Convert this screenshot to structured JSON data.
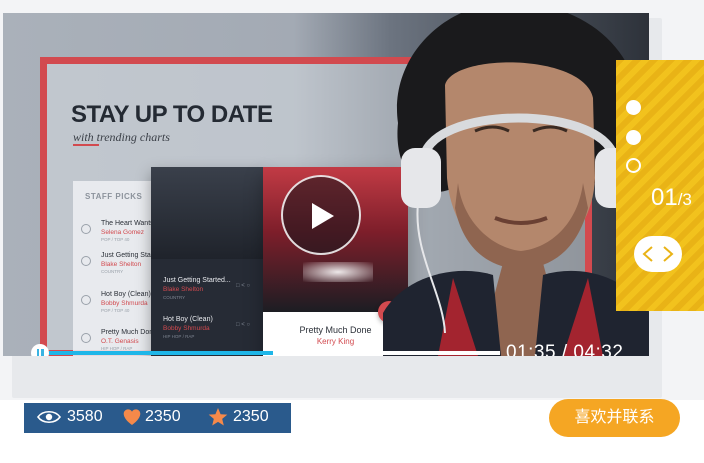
{
  "slide": {
    "title": "STAY UP TO DATE",
    "subtitle": "with trending charts"
  },
  "staff_picks": {
    "heading": "STAFF PICKS",
    "items": [
      {
        "title": "The Heart Wants",
        "artist": "Selena Gomez",
        "genre": "POP / TOP 40"
      },
      {
        "title": "Just Getting Sta",
        "artist": "Blake Shelton",
        "genre": "COUNTRY"
      },
      {
        "title": "Hot Boy (Clean)",
        "artist": "Bobby Shmurda",
        "genre": "POP / TOP 40"
      },
      {
        "title": "Pretty Much Don",
        "artist": "O.T. Genasis",
        "genre": "HIP HOP / RAP"
      }
    ]
  },
  "dark_panel": {
    "items": [
      {
        "title": "Just Getting Started...",
        "artist": "Blake Shelton",
        "genre": "COUNTRY"
      },
      {
        "title": "Hot Boy (Clean)",
        "artist": "Bobby Shmurda",
        "genre": "HIP HOP / RAP"
      }
    ]
  },
  "now_playing": {
    "title": "Pretty Much Done",
    "artist": "Kerry King",
    "add_symbol": "+"
  },
  "player": {
    "progress": 0.5,
    "time_text": "01:35 / 04:32"
  },
  "slider": {
    "current": "01",
    "total": "/3",
    "dots": [
      "filled",
      "filled",
      "empty"
    ]
  },
  "stats": {
    "views": "3580",
    "likes": "2350",
    "favorites": "2350"
  },
  "cta_label": "喜欢并联系",
  "colors": {
    "accent_red": "#d24a4f",
    "progress_blue": "#1fb6e8",
    "rail_yellow": "#f2c21d",
    "stats_blue": "#2a5a8c",
    "like_orange": "#f5894a",
    "cta_orange": "#f5a623"
  }
}
